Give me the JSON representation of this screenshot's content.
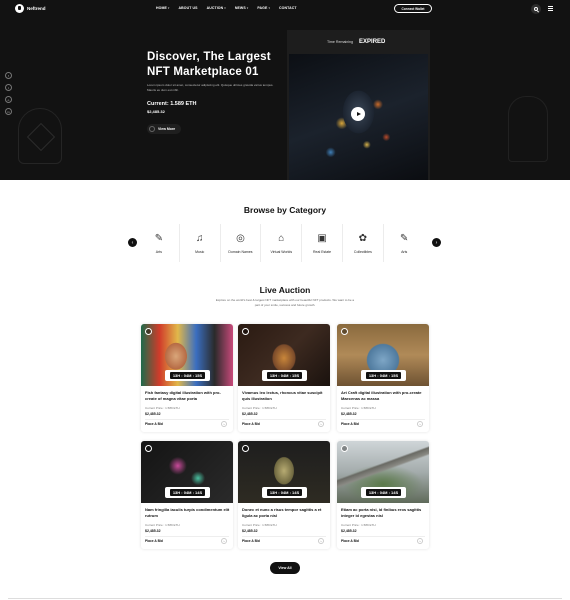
{
  "header": {
    "logo_text": "Neftrend",
    "nav": [
      "HOME",
      "ABOUT US",
      "AUCTION",
      "NEWS",
      "PAGE",
      "CONTACT"
    ],
    "nav_dropdown": [
      true,
      false,
      true,
      true,
      true,
      false
    ],
    "connect_wallet": "Connect Wallet"
  },
  "social": [
    {
      "icon": "facebook-icon",
      "glyph": "f"
    },
    {
      "icon": "twitter-icon",
      "glyph": "t"
    },
    {
      "icon": "instagram-icon",
      "glyph": "o"
    },
    {
      "icon": "linkedin-icon",
      "glyph": "in"
    }
  ],
  "hero": {
    "title": "Discover, The Largest NFT Marketplace 01",
    "description": "Lorem ipsum dolor sit amet, consectetur adipiscing elit. Quisque ultrices gravida varius tempus. Mauris eu dum est nibh.",
    "current": "Current: 1.589 ETH",
    "usd": "$2,485.32",
    "more_button": "View More"
  },
  "feature": {
    "time_remaining_label": "Time Remaining",
    "status": "EXPIRED"
  },
  "categories": {
    "title": "Browse by Category",
    "items": [
      {
        "label": "Arts",
        "glyph": "✎"
      },
      {
        "label": "Music",
        "glyph": "♫"
      },
      {
        "label": "Domain Names",
        "glyph": "◎"
      },
      {
        "label": "Virtual Worlds",
        "glyph": "⌂"
      },
      {
        "label": "Real Estate",
        "glyph": "▣"
      },
      {
        "label": "Collectibles",
        "glyph": "✿"
      },
      {
        "label": "Arts",
        "glyph": "✎"
      }
    ]
  },
  "auction": {
    "title": "Live Auction",
    "description": "Explore on the world's best & largest NFT marketplace with our beautiful NFT products. We want to be a part of your smile, success and future growth.",
    "place_bid": "Place A Bid",
    "view_all": "View All",
    "cards": [
      {
        "timer": "13H : 04M : 15S",
        "title": "Fish fantasy digital illustration with pro-create of magna vitae porta",
        "price": "Current Price : 1.589 ETH",
        "usd": "$2,485.32",
        "art": "art1"
      },
      {
        "timer": "13H : 04M : 15S",
        "title": "Vivamus leo lectus, rhoncus vitae suscipit quis illustration",
        "price": "Current Price : 1.589 ETH",
        "usd": "$2,485.32",
        "art": "art2"
      },
      {
        "timer": "13H : 04M : 15S",
        "title": "Art Craft digital illustration with pro-create Maecenas ac massa",
        "price": "Current Price : 1.589 ETH",
        "usd": "$2,485.32",
        "art": "art3"
      },
      {
        "timer": "13H : 04M : 14S",
        "title": "Nam fringilla iaculis turpis condimentum elit rutrum",
        "price": "Current Price : 1.589 ETH",
        "usd": "$2,485.32",
        "art": "art4"
      },
      {
        "timer": "13H : 04M : 14S",
        "title": "Donec et nunc a risus tempor sagittis a et ligula ac porta nisl",
        "price": "Current Price : 1.589 ETH",
        "usd": "$2,485.32",
        "art": "art5"
      },
      {
        "timer": "13H : 04M : 14S",
        "title": "Etiam ac porta nisi, id finibus eros sagittis integer id egestas nisl",
        "price": "Current Price : 1.589 ETH",
        "usd": "$2,485.32",
        "art": "art6"
      }
    ]
  },
  "colors": {
    "hero_bg": "#121212",
    "accent": "#111111",
    "text_muted": "#777777"
  }
}
